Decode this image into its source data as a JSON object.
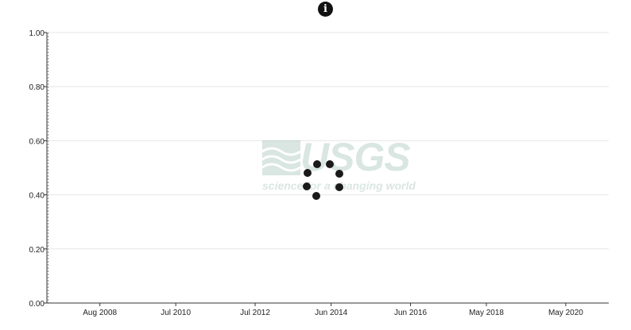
{
  "header": {
    "info_icon": "info-icon",
    "info_glyph": "i"
  },
  "watermark": {
    "logo_text": "USGS",
    "tagline": "science for a changing world"
  },
  "loading": {
    "icon": "loading-spinner-icon",
    "dots": 7
  },
  "chart_data": {
    "type": "line",
    "title": "",
    "xlabel": "",
    "ylabel": "",
    "ylim": [
      0,
      1
    ],
    "yticks": [
      0,
      0.2,
      0.4,
      0.6,
      0.8,
      1.0
    ],
    "ytick_labels": [
      "0.00",
      "0.20",
      "0.40",
      "0.60",
      "0.80",
      "1.00"
    ],
    "xlim": [
      "2007-04-01",
      "2021-06-01"
    ],
    "xticks": [
      "2008-08-01",
      "2010-07-01",
      "2012-07-01",
      "2014-06-01",
      "2016-06-01",
      "2018-05-01",
      "2020-05-01"
    ],
    "xtick_labels": [
      "Aug 2008",
      "Jul 2010",
      "Jul 2012",
      "Jun 2014",
      "Jun 2016",
      "May 2018",
      "May 2020"
    ],
    "grid": true,
    "series": []
  }
}
